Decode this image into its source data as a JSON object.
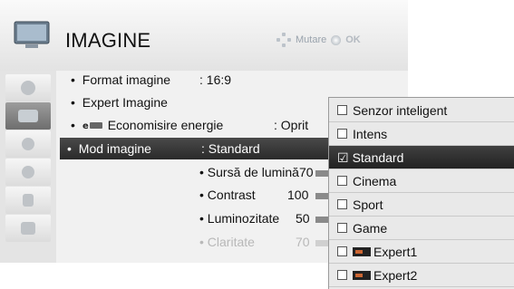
{
  "header": {
    "title": "IMAGINE",
    "hint_move": "Mutare",
    "hint_ok": "OK"
  },
  "menu": {
    "rows": [
      {
        "label": "Format imagine",
        "value": ": 16:9"
      },
      {
        "label": "Expert Imagine",
        "value": ""
      },
      {
        "label": "Economisire energie",
        "value": ": Oprit"
      },
      {
        "label": "Mod imagine",
        "value": ": Standard"
      }
    ],
    "settings": [
      {
        "label": "• Sursă de lumină",
        "value": "70"
      },
      {
        "label": "• Contrast",
        "value": "100"
      },
      {
        "label": "• Luminozitate",
        "value": "50"
      },
      {
        "label": "• Claritate",
        "value": "70"
      }
    ]
  },
  "dropdown": {
    "options": [
      "Senzor inteligent",
      "Intens",
      "Standard",
      "Cinema",
      "Sport",
      "Game",
      "Expert1",
      "Expert2"
    ],
    "selected": "Standard"
  }
}
